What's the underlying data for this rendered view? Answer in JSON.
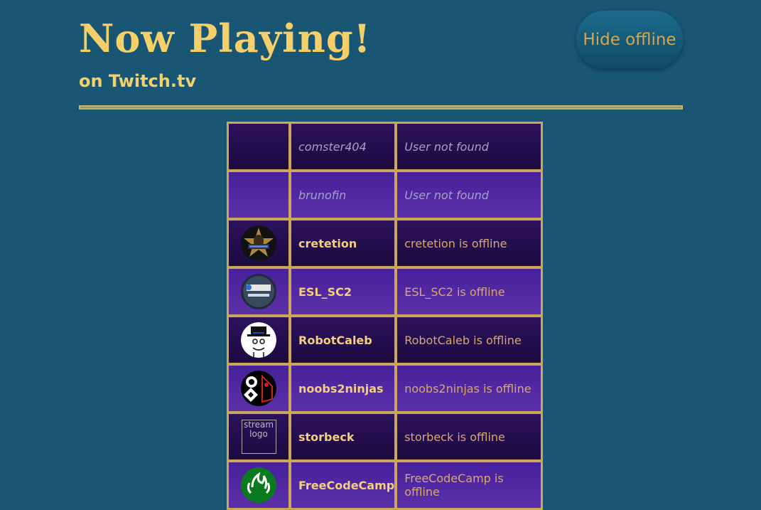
{
  "header": {
    "title": "Now Playing!",
    "subtitle": "on Twitch.tv",
    "toggle_label": "Hide offline"
  },
  "colors": {
    "background": "#185674",
    "accent": "#f5cf6a",
    "row_dark": "#230c4d",
    "row_light": "#4f2aa0",
    "border": "#caa55a"
  },
  "streams": [
    {
      "name": "comster404",
      "status": "User not found",
      "logo": "none",
      "state": "not-found"
    },
    {
      "name": "brunofin",
      "status": "User not found",
      "logo": "none",
      "state": "not-found"
    },
    {
      "name": "cretetion",
      "status": "cretetion is offline",
      "logo": "cretetion-logo",
      "state": "offline"
    },
    {
      "name": "ESL_SC2",
      "status": "ESL_SC2 is offline",
      "logo": "esl-logo",
      "state": "offline"
    },
    {
      "name": "RobotCaleb",
      "status": "RobotCaleb is offline",
      "logo": "robotcaleb-logo",
      "state": "offline"
    },
    {
      "name": "noobs2ninjas",
      "status": "noobs2ninjas is offline",
      "logo": "noobs2ninjas-logo",
      "state": "offline"
    },
    {
      "name": "storbeck",
      "status": "storbeck is offline",
      "logo": "broken-image",
      "logo_alt": "stream logo",
      "state": "offline"
    },
    {
      "name": "FreeCodeCamp",
      "status": "FreeCodeCamp is offline",
      "logo": "freecodecamp-logo",
      "state": "offline"
    }
  ]
}
